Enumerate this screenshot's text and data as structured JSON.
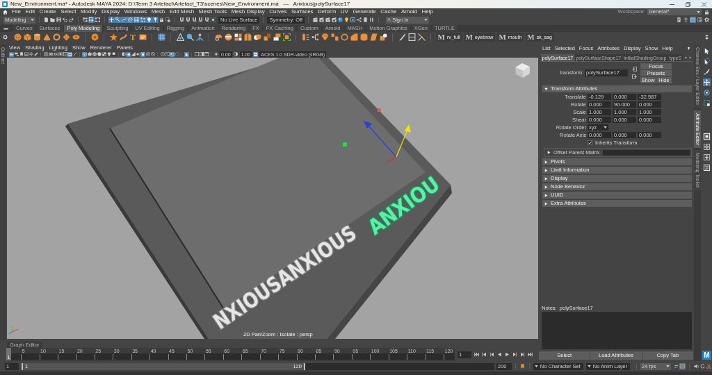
{
  "window": {
    "title": "New_Environment.ma* - Autodesk MAYA 2024: D:\\Term 3 Artefact\\Artefact_T3\\scenes\\New_Environment.ma   ---   Anxious|polySurface17"
  },
  "menu_bar": {
    "items": [
      "File",
      "Edit",
      "Create",
      "Select",
      "Modify",
      "Display",
      "Windows",
      "Mesh",
      "Edit Mesh",
      "Mesh Tools",
      "Mesh Display",
      "Curves",
      "Surfaces",
      "Deform",
      "UV",
      "Generate",
      "Cache",
      "Arnold",
      "Help"
    ],
    "workspace_label": "Workspace:",
    "workspace": "General*"
  },
  "status_line": {
    "menu_set": "Modeling",
    "select_modes": [
      {
        "kind": "hierarchy",
        "on": false
      },
      {
        "kind": "object",
        "on": true
      },
      {
        "kind": "component",
        "on": false
      }
    ],
    "selection_masks": [
      {
        "kind": "cross",
        "on": true
      },
      {
        "kind": "joint",
        "on": true
      },
      {
        "kind": "curve",
        "on": true
      },
      {
        "kind": "surface",
        "on": true
      },
      {
        "kind": "lattice",
        "on": true
      },
      {
        "kind": "particles",
        "on": true
      },
      {
        "kind": "bulb",
        "on": true
      },
      {
        "kind": "pin",
        "on": true
      }
    ],
    "live_surface": "No Live Surface",
    "symmetry": "Symmetry: Off",
    "sign_in": "Sign In",
    "panel_toggles": [
      {
        "kind": "toolkit",
        "on": false
      },
      {
        "kind": "figure",
        "on": false
      },
      {
        "kind": "attr_editor",
        "on": true
      },
      {
        "kind": "tool_settings",
        "on": false
      },
      {
        "kind": "channel_box",
        "on": false
      }
    ]
  },
  "shelf": {
    "tabs": [
      {
        "label": "Curves",
        "selected": false
      },
      {
        "label": "Surfaces",
        "selected": false
      },
      {
        "label": "Poly Modeling",
        "selected": true
      },
      {
        "label": "Sculpting",
        "selected": false
      },
      {
        "label": "UV Editing",
        "selected": false
      },
      {
        "label": "Rigging",
        "selected": false
      },
      {
        "label": "Animation",
        "selected": false
      },
      {
        "label": "Rendering",
        "selected": false
      },
      {
        "label": "FX",
        "selected": false
      },
      {
        "label": "FX Caching",
        "selected": false
      },
      {
        "label": "Custom",
        "selected": false
      },
      {
        "label": "Arnold",
        "selected": false
      },
      {
        "label": "MASH",
        "selected": false
      },
      {
        "label": "Motion Graphics",
        "selected": false
      },
      {
        "label": "XGen",
        "selected": false
      },
      {
        "label": "TURTLE",
        "selected": false
      }
    ],
    "type_glyph": "T",
    "script_tools": [
      {
        "glyph": "M",
        "label": "rv_full"
      },
      {
        "glyph": "M",
        "label": "eyebrow"
      },
      {
        "glyph": "M",
        "label": "mouth"
      },
      {
        "glyph": "M",
        "label": "sk_sag"
      }
    ]
  },
  "outliner_tab": "Outliner",
  "viewport": {
    "menu": [
      "View",
      "Shading",
      "Lighting",
      "Show",
      "Renderer",
      "Panels"
    ],
    "toolbar_groups": [
      [
        {
          "kind": "camera",
          "on": true
        },
        {
          "kind": "camera_lock",
          "on": false
        },
        {
          "kind": "bookmark",
          "on": false
        },
        {
          "kind": "image_plane",
          "on": false
        },
        {
          "kind": "pan_zoom",
          "on": false
        },
        {
          "kind": "pencil",
          "on": false
        }
      ],
      [
        {
          "kind": "grid",
          "on": false
        },
        {
          "kind": "film_gate",
          "on": false
        },
        {
          "kind": "res_gate",
          "on": false
        },
        {
          "kind": "gate_mask",
          "on": false
        },
        {
          "kind": "field_chart",
          "on": false
        },
        {
          "kind": "safe_action",
          "on": true
        },
        {
          "kind": "safe_title",
          "on": false
        }
      ],
      [
        {
          "kind": "wireframe",
          "on": true
        },
        {
          "kind": "shaded",
          "on": false
        },
        {
          "kind": "wire_shaded",
          "on": false
        },
        {
          "kind": "default_material",
          "on": false
        },
        {
          "kind": "textured",
          "on": false
        },
        {
          "kind": "lights",
          "on": false
        },
        {
          "kind": "shadows",
          "on": false
        }
      ],
      [
        {
          "kind": "ao",
          "on": false
        },
        {
          "kind": "motion_blur",
          "on": true
        },
        {
          "kind": "anti_alias",
          "on": false
        },
        {
          "kind": "dof",
          "on": false
        },
        {
          "kind": "isolate",
          "on": true
        },
        {
          "kind": "xray",
          "on": false
        },
        {
          "kind": "xray_joints",
          "on": false
        }
      ],
      [
        {
          "kind": "xray_active",
          "on": false
        },
        {
          "kind": "backface",
          "on": false
        },
        {
          "kind": "hud",
          "on": true
        },
        {
          "kind": "hidden",
          "on": false
        }
      ],
      [
        {
          "kind": "highlight",
          "on": true
        }
      ],
      [
        {
          "kind": "wire_color",
          "on": false
        },
        {
          "kind": "shaded_color",
          "on": false
        },
        {
          "kind": "flat_color",
          "on": false
        }
      ]
    ],
    "exposure": "0.00",
    "gamma": "1.00",
    "view_transform": {
      "on": true,
      "label": "ACES 1.0 SDR-video (sRGB)"
    },
    "scene_text": [
      {
        "text": "NXIOUSANXIOUS",
        "selected": false
      },
      {
        "text": "ANXIOU",
        "selected": true
      }
    ],
    "hud": "2D Pan/Zoom : Isolate : persp"
  },
  "attribute_editor": {
    "menu": [
      "List",
      "Selected",
      "Focus",
      "Attributes",
      "Display",
      "Show",
      "Help"
    ],
    "tabs": [
      {
        "label": "polySurface17",
        "selected": true
      },
      {
        "label": "polySurfaceShape17",
        "selected": false
      },
      {
        "label": "initialShadingGroup",
        "selected": false
      },
      {
        "label": "typeS",
        "selected": false
      }
    ],
    "node_label": "transform:",
    "node_name": "polySurface17",
    "node_buttons": [
      "Focus",
      "Presets",
      "Show",
      "Hide"
    ],
    "sections": [
      {
        "kind": "header",
        "title": "Transform Attributes",
        "expanded": true,
        "rows": [
          {
            "kind": "vector",
            "label": "Translate",
            "values": [
              "-0.129",
              "0.000",
              "-32.587"
            ]
          },
          {
            "kind": "vector",
            "label": "Rotate",
            "values": [
              "0.000",
              "90.000",
              "0.000"
            ]
          },
          {
            "kind": "vector",
            "label": "Scale",
            "values": [
              "1.000",
              "1.000",
              "1.000"
            ]
          },
          {
            "kind": "vector",
            "label": "Shear",
            "values": [
              "0.000",
              "0.000",
              "0.000"
            ]
          },
          {
            "kind": "dropdown",
            "label": "Rotate Order",
            "value": "xyz"
          },
          {
            "kind": "vector",
            "label": "Rotate Axis",
            "values": [
              "0.000",
              "0.000",
              "0.000"
            ]
          },
          {
            "kind": "checkbox",
            "label": "Inherits Transform",
            "checked": true
          }
        ]
      },
      {
        "kind": "framed",
        "title": "Offset Parent Matrix",
        "expanded": false
      },
      {
        "kind": "header",
        "title": "Pivots",
        "expanded": false
      },
      {
        "kind": "header",
        "title": "Limit Information",
        "expanded": false
      },
      {
        "kind": "header",
        "title": "Display",
        "expanded": false
      },
      {
        "kind": "header",
        "title": "Node Behavior",
        "expanded": false
      },
      {
        "kind": "header",
        "title": "UUID",
        "expanded": false
      },
      {
        "kind": "header",
        "title": "Extra Attributes",
        "expanded": false
      }
    ],
    "notes_label": "Notes:  polySurface17",
    "buttons": [
      "Select",
      "Load Attributes",
      "Copy Tab"
    ]
  },
  "side_tabs": [
    {
      "label": "Channel Box / Layer Editor",
      "selected": false
    },
    {
      "label": "Attribute Editor",
      "selected": true
    },
    {
      "label": "Modeling Toolkit",
      "selected": false
    }
  ],
  "toolbox": {
    "tools": [
      {
        "kind": "select",
        "selected": false
      },
      {
        "kind": "lasso",
        "selected": false
      },
      {
        "kind": "paint",
        "selected": false
      },
      {
        "kind": "move",
        "selected": true
      },
      {
        "kind": "rotate",
        "selected": false
      },
      {
        "kind": "scale",
        "selected": false
      }
    ],
    "layouts": [
      {
        "kind": "single",
        "selected": true
      },
      {
        "kind": "four",
        "selected": false
      },
      {
        "kind": "two",
        "selected": false
      },
      {
        "kind": "outliner",
        "selected": false
      }
    ],
    "logo": "M"
  },
  "graph_editor_tab": "Graph Editor",
  "time_slider": {
    "ticks": [
      "5",
      "10",
      "15",
      "20",
      "25",
      "30",
      "35",
      "40",
      "45",
      "50",
      "55",
      "60",
      "65",
      "70",
      "75",
      "80",
      "85",
      "90",
      "95",
      "100",
      "105",
      "110",
      "115",
      "120"
    ],
    "current_frame": "1",
    "level": 0,
    "frame_field": "1"
  },
  "range_slider": {
    "start": "1",
    "range_start": "1",
    "range_end": "120",
    "level": 0.6,
    "end": "200",
    "character_set": "No Character Set",
    "anim_layer": "No Anim Layer",
    "fps": "24 fps",
    "toggles": [
      {
        "kind": "loop",
        "on": false
      },
      {
        "kind": "cache",
        "on": true
      }
    ]
  }
}
